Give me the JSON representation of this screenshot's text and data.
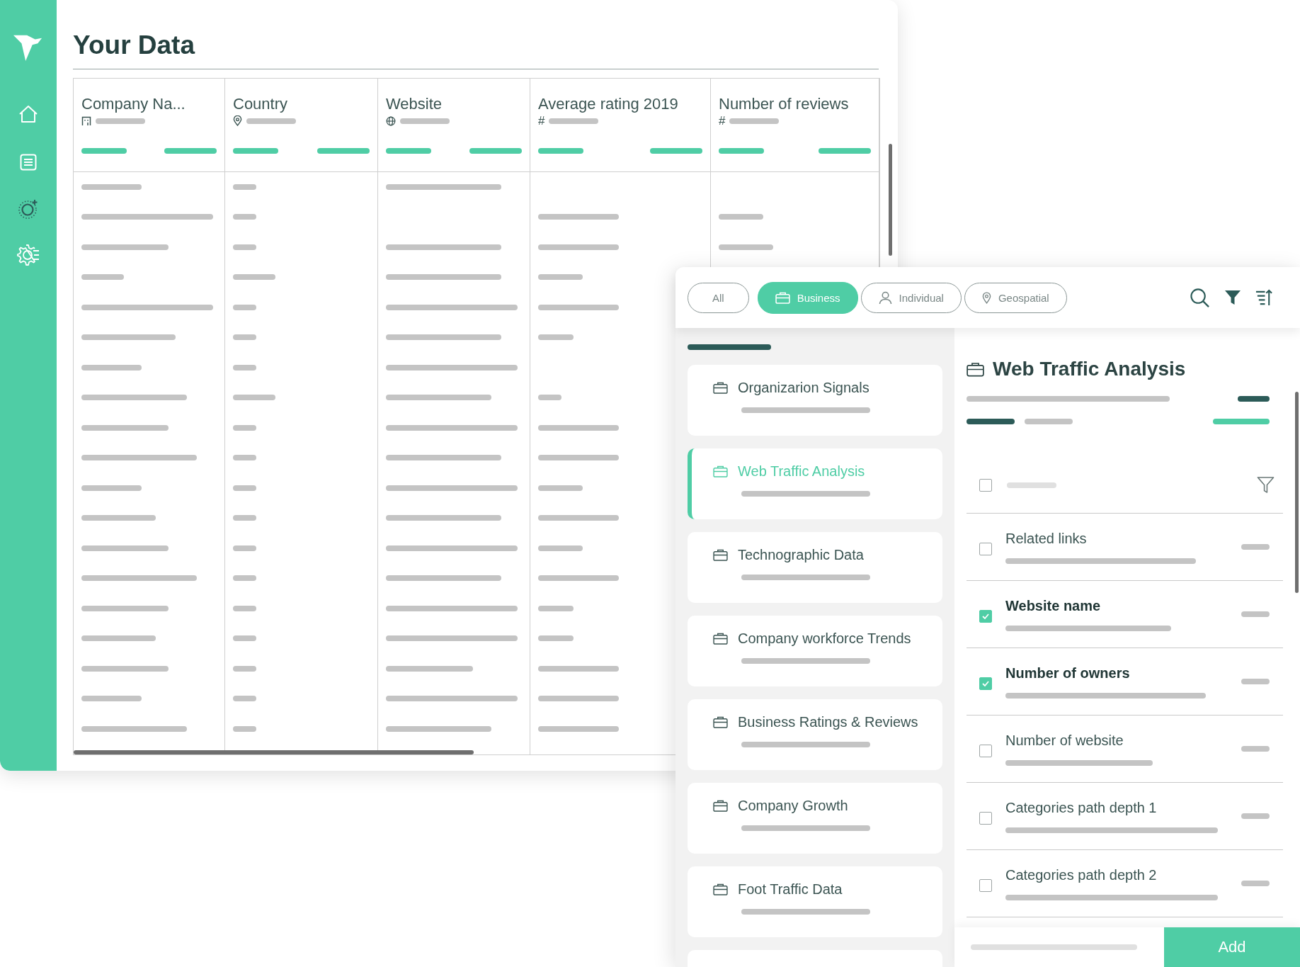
{
  "data_panel": {
    "title": "Your Data",
    "columns": [
      {
        "name": "Company Na...",
        "kind": "company"
      },
      {
        "name": "Country",
        "kind": "location"
      },
      {
        "name": "Website",
        "kind": "url"
      },
      {
        "name": "Average rating 2019",
        "kind": "number",
        "symbol": "#"
      },
      {
        "name": "Number of reviews",
        "kind": "number",
        "symbol": "#"
      }
    ]
  },
  "selector": {
    "filters": [
      {
        "label": "All",
        "kind": "all",
        "selected": false
      },
      {
        "label": "Business",
        "kind": "business",
        "selected": true
      },
      {
        "label": "Individual",
        "kind": "individual",
        "selected": false
      },
      {
        "label": "Geospatial",
        "kind": "geospatial",
        "selected": false
      }
    ],
    "categories": [
      {
        "title": "Organizarion Signals",
        "selected": false
      },
      {
        "title": "Web Traffic Analysis",
        "selected": true
      },
      {
        "title": "Technographic Data",
        "selected": false
      },
      {
        "title": "Company workforce Trends",
        "selected": false
      },
      {
        "title": "Business Ratings & Reviews",
        "selected": false
      },
      {
        "title": "Company Growth",
        "selected": false
      },
      {
        "title": "Foot Traffic Data",
        "selected": false
      }
    ],
    "detail": {
      "title": "Web Traffic Analysis",
      "select_all": {
        "checked": false
      },
      "fields": [
        {
          "label": "Related links",
          "checked": false
        },
        {
          "label": "Website name",
          "checked": true
        },
        {
          "label": "Number of owners",
          "checked": true
        },
        {
          "label": "Number of website",
          "checked": false
        },
        {
          "label": "Categories path depth 1",
          "checked": false
        },
        {
          "label": "Categories path depth 2",
          "checked": false
        }
      ],
      "button": "Add"
    }
  }
}
